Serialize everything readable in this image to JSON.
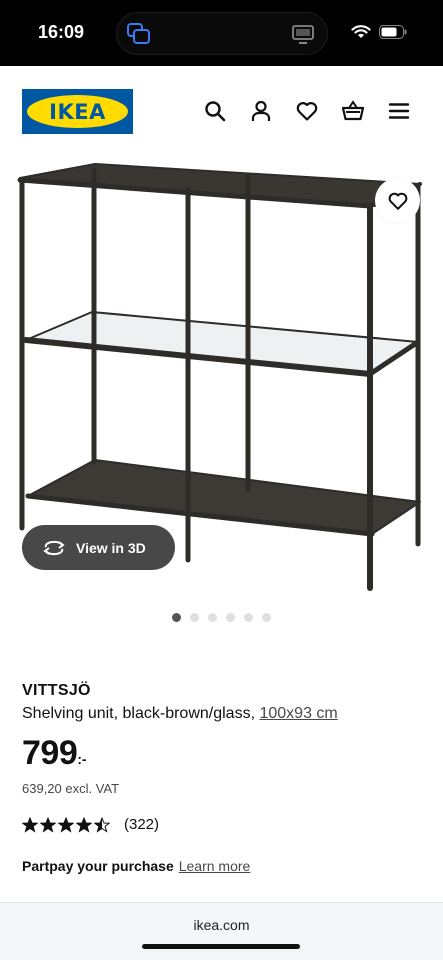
{
  "status_bar": {
    "time": "16:09"
  },
  "header": {
    "logo_text": "IKEA",
    "icons": [
      "search-icon",
      "user-icon",
      "heart-icon",
      "basket-icon",
      "menu-icon"
    ]
  },
  "product": {
    "view3d_label": "View in 3D",
    "carousel": {
      "total": 6,
      "active": 1
    },
    "name": "VITTSJÖ",
    "description": "Shelving unit, black-brown/glass,",
    "size": "100x93 cm",
    "price_integer": "799",
    "price_suffix": ":-",
    "price_excl_vat": "639,20 excl. VAT",
    "rating": 4.5,
    "rating_max": 5,
    "review_count": "(322)",
    "partpay_label": "Partpay your purchase",
    "learn_more": "Learn more"
  },
  "browser": {
    "url": "ikea.com"
  },
  "colors": {
    "ikea_blue": "#0058a3",
    "ikea_yellow": "#ffdb00",
    "view3d_bg": "#484848",
    "frame": "#2e2c28"
  }
}
